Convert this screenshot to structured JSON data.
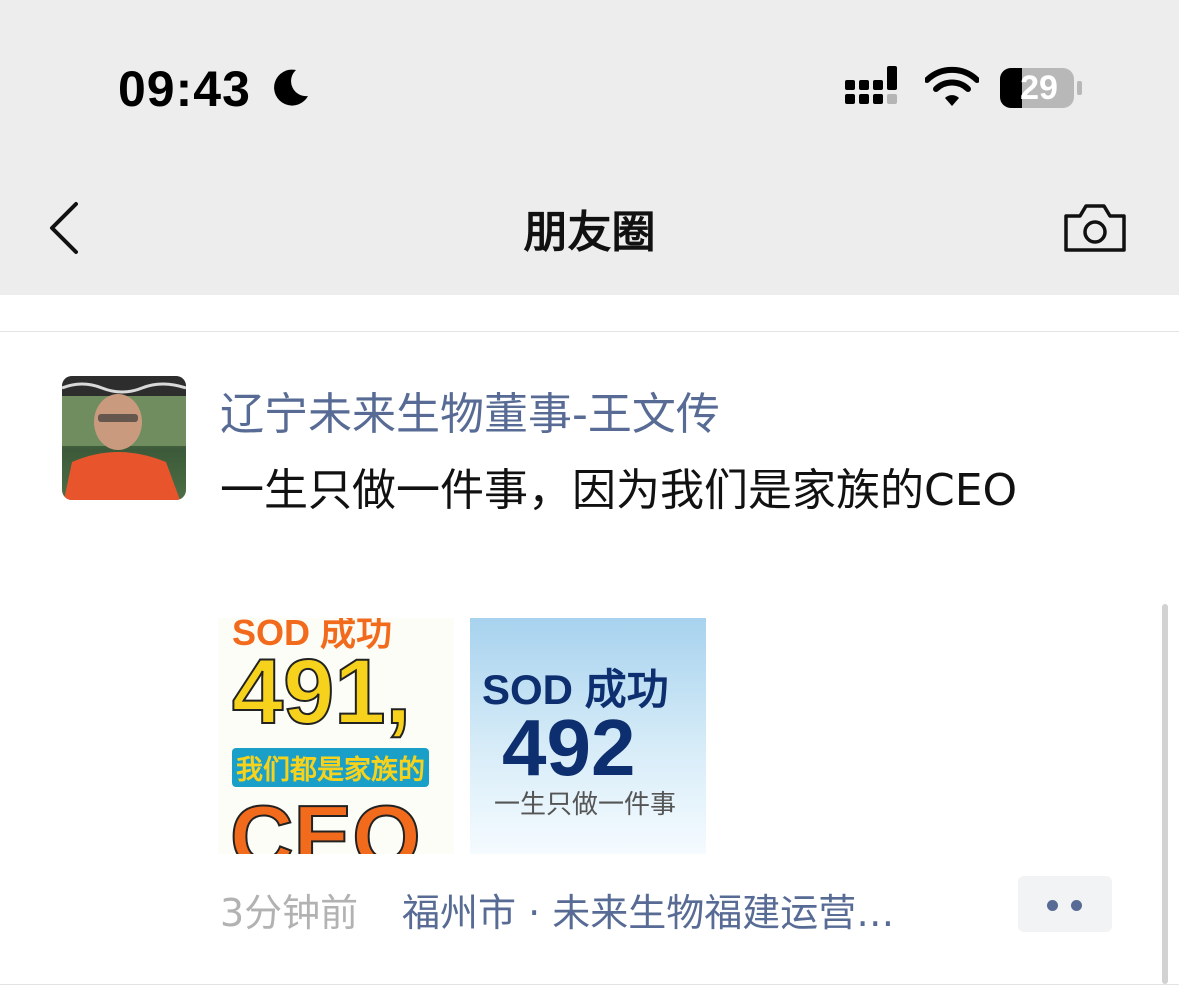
{
  "status_bar": {
    "time": "09:43",
    "battery": "29",
    "icons": [
      "moon-icon",
      "signal-icon",
      "wifi-icon",
      "battery-icon"
    ]
  },
  "nav": {
    "title": "朋友圈",
    "back_icon": "chevron-left-icon",
    "camera_icon": "camera-icon"
  },
  "post": {
    "author": "辽宁未来生物董事-王文传",
    "text": "一生只做一件事，因为我们是家族的CEO",
    "images": [
      {
        "top_text": "SOD 成功",
        "number": "491,",
        "subtitle": "我们都是家族的",
        "bottom_text": "CEO"
      },
      {
        "title": "SOD 成功",
        "number": "492",
        "subtitle": "一生只做一件事"
      }
    ],
    "time": "3分钟前",
    "location": "福州市 · 未来生物福建运营…"
  },
  "colors": {
    "link": "#576b95",
    "meta": "#b2b2b2",
    "topbar": "#ededed"
  }
}
